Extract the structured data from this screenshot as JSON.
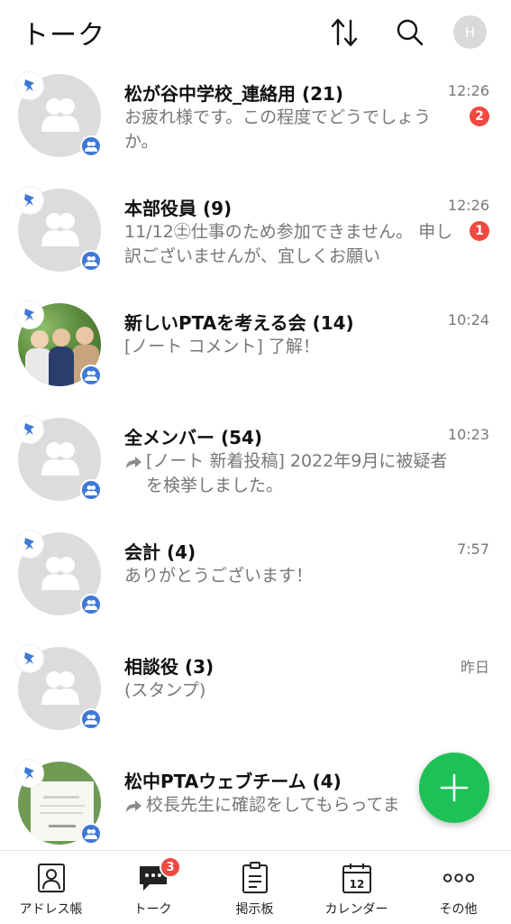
{
  "header": {
    "title": "トーク",
    "avatar_initial": "H"
  },
  "chats": [
    {
      "name": "松が谷中学校_連絡用 (21)",
      "time": "12:26",
      "message": "お疲れ様です。この程度でどうでしょうか。",
      "unread": "2",
      "avatar": "default",
      "forwarded": false
    },
    {
      "name": "本部役員 (9)",
      "time": "12:26",
      "message": "11/12㊏仕事のため参加できません。 申し訳ございませんが、宜しくお願い",
      "unread": "1",
      "avatar": "default",
      "forwarded": false
    },
    {
      "name": "新しいPTAを考える会 (14)",
      "time": "10:24",
      "message": "[ノート コメント] 了解！",
      "unread": "",
      "avatar": "photo",
      "forwarded": false
    },
    {
      "name": "全メンバー (54)",
      "time": "10:23",
      "message": "[ノート 新着投稿] 2022年9月に被疑者を検挙しました。",
      "unread": "",
      "avatar": "default",
      "forwarded": true
    },
    {
      "name": "会計 (4)",
      "time": "7:57",
      "message": "ありがとうございます！",
      "unread": "",
      "avatar": "default",
      "forwarded": false
    },
    {
      "name": "相談役 (3)",
      "time": "昨日",
      "message": "(スタンプ)",
      "unread": "",
      "avatar": "default",
      "forwarded": false
    },
    {
      "name": "松中PTAウェブチーム (4)",
      "time": "",
      "message": "校長先生に確認をしてもらってま",
      "unread": "",
      "avatar": "doc",
      "forwarded": true
    }
  ],
  "tabs": [
    {
      "label": "アドレス帳",
      "icon": "address-book-icon"
    },
    {
      "label": "トーク",
      "icon": "chat-bubble-icon",
      "badge": "3"
    },
    {
      "label": "掲示板",
      "icon": "board-icon"
    },
    {
      "label": "カレンダー",
      "icon": "calendar-icon",
      "day": "12"
    },
    {
      "label": "その他",
      "icon": "more-icon"
    }
  ],
  "colors": {
    "accent_green": "#1ec155",
    "unread_red": "#f2483f",
    "group_blue": "#3f78d6"
  }
}
